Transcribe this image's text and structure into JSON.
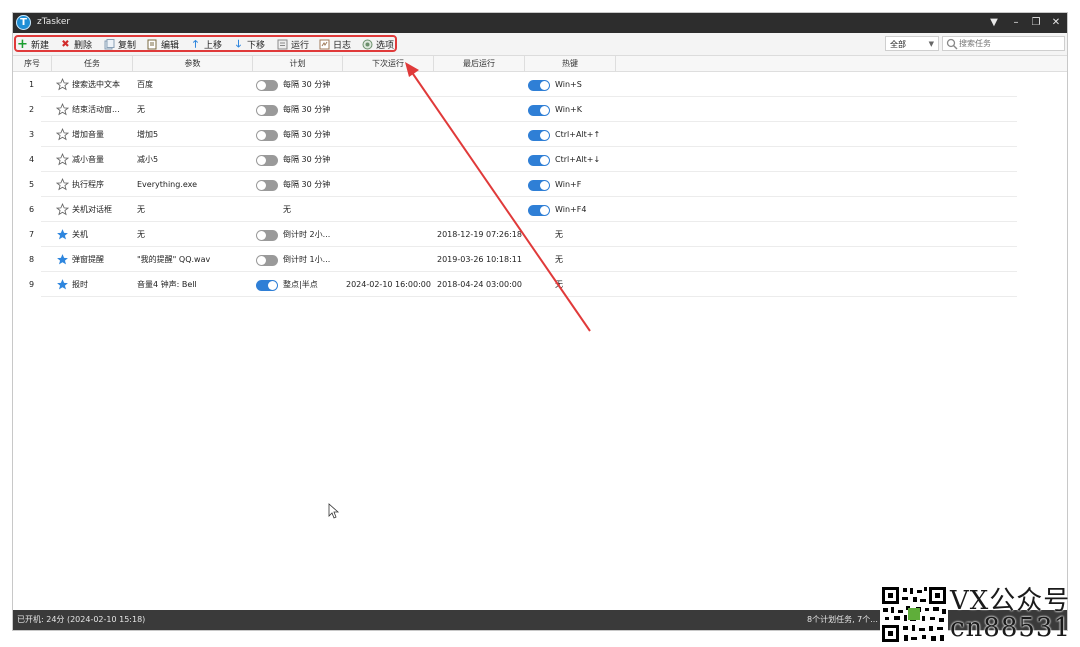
{
  "window": {
    "title": "zTasker",
    "app_icon_letter": "T"
  },
  "toolbar": {
    "buttons": [
      {
        "label": "新建",
        "icon": "plus-icon",
        "color": "#1b9e2f"
      },
      {
        "label": "删除",
        "icon": "x-icon",
        "color": "#d22b2b"
      },
      {
        "label": "复制",
        "icon": "copy-icon",
        "color": "#8aa0b6"
      },
      {
        "label": "编辑",
        "icon": "edit-icon",
        "color": "#7a6a40"
      },
      {
        "label": "上移",
        "icon": "arrow-up-icon",
        "color": "#2e86de"
      },
      {
        "label": "下移",
        "icon": "arrow-down-icon",
        "color": "#2e86de"
      },
      {
        "label": "运行",
        "icon": "run-icon",
        "color": "#8a8a8a"
      },
      {
        "label": "日志",
        "icon": "log-icon",
        "color": "#a07a5a"
      },
      {
        "label": "选项",
        "icon": "options-icon",
        "color": "#6b8f6b"
      }
    ],
    "filter": {
      "selected": "全部"
    },
    "search": {
      "placeholder": "搜索任务"
    }
  },
  "columns": [
    "序号",
    "任务",
    "参数",
    "计划",
    "下次运行",
    "最后运行",
    "热键"
  ],
  "rows": [
    {
      "no": "1",
      "task": "搜索选中文本",
      "param": "百度",
      "toggle": "off",
      "plan": "每隔 30 分钟",
      "next": "",
      "last": "",
      "hotkey_toggle": "on",
      "hotkey": "Win+S",
      "starred": false
    },
    {
      "no": "2",
      "task": "结束活动窗...",
      "param": "无",
      "toggle": "off",
      "plan": "每隔 30 分钟",
      "next": "",
      "last": "",
      "hotkey_toggle": "on",
      "hotkey": "Win+K",
      "starred": false
    },
    {
      "no": "3",
      "task": "增加音量",
      "param": "增加5",
      "toggle": "off",
      "plan": "每隔 30 分钟",
      "next": "",
      "last": "",
      "hotkey_toggle": "on",
      "hotkey": "Ctrl+Alt+↑",
      "starred": false
    },
    {
      "no": "4",
      "task": "减小音量",
      "param": "减小5",
      "toggle": "off",
      "plan": "每隔 30 分钟",
      "next": "",
      "last": "",
      "hotkey_toggle": "on",
      "hotkey": "Ctrl+Alt+↓",
      "starred": false
    },
    {
      "no": "5",
      "task": "执行程序",
      "param": "Everything.exe",
      "toggle": "off",
      "plan": "每隔 30 分钟",
      "next": "",
      "last": "",
      "hotkey_toggle": "on",
      "hotkey": "Win+F",
      "starred": false
    },
    {
      "no": "6",
      "task": "关机对话框",
      "param": "无",
      "toggle": "none",
      "plan": "无",
      "next": "",
      "last": "",
      "hotkey_toggle": "on",
      "hotkey": "Win+F4",
      "starred": false
    },
    {
      "no": "7",
      "task": "关机",
      "param": "无",
      "toggle": "off",
      "plan": "倒计时 2小...",
      "next": "",
      "last": "2018-12-19 07:26:18",
      "hotkey_toggle": "none",
      "hotkey": "无",
      "starred": true
    },
    {
      "no": "8",
      "task": "弹窗提醒",
      "param": "\"我的提醒\" QQ.wav",
      "toggle": "off",
      "plan": "倒计时 1小...",
      "next": "",
      "last": "2019-03-26 10:18:11",
      "hotkey_toggle": "none",
      "hotkey": "无",
      "starred": true
    },
    {
      "no": "9",
      "task": "报时",
      "param": "音量4 钟声: Bell",
      "toggle": "on",
      "plan": "整点|半点",
      "next": "2024-02-10 16:00:00",
      "last": "2018-04-24 03:00:00",
      "hotkey_toggle": "none",
      "hotkey": "无",
      "starred": true
    }
  ],
  "status": {
    "left": "已开机: 24分 (2024-02-10 15:18)",
    "right": "8个计划任务, 7个..."
  },
  "watermark": {
    "line1": "VX公众号",
    "line2": "cn88531"
  },
  "colors": {
    "accent": "#2f7fd6",
    "highlight": "#e03a3a",
    "star": "#2e86de"
  }
}
